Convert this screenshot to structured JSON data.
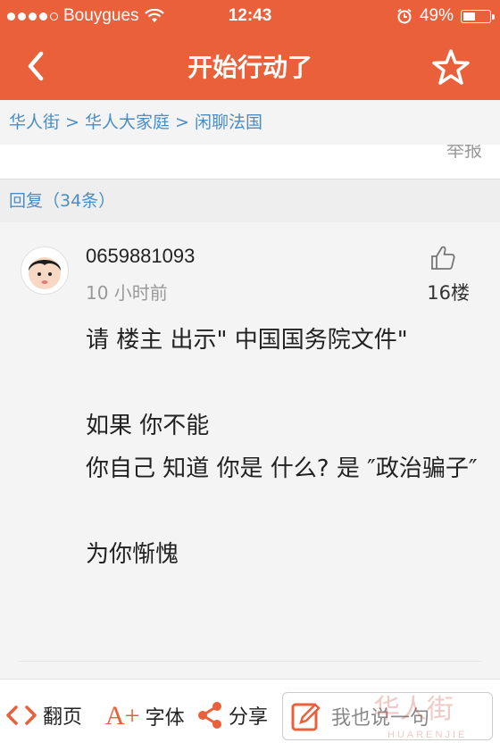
{
  "status": {
    "carrier": "Bouygues",
    "time": "12:43",
    "battery": "49%",
    "battery_level": 0.49
  },
  "nav": {
    "title": "开始行动了",
    "back_icon": "chevron-left-icon",
    "favorite_icon": "star-icon"
  },
  "breadcrumb": "华人街 > 华人大家庭 > 闲聊法国",
  "strip": {
    "report": "举报"
  },
  "replies_header": "回复（34条）",
  "post": {
    "username": "0659881093",
    "time": "10 小时前",
    "floor": "16楼",
    "lines": [
      "请 楼主 出示\" 中国国务院文件\"",
      "",
      "如果 你不能",
      "你自己 知道 你是 什么? 是 ″政治骗子″",
      "",
      "为你惭愧"
    ]
  },
  "toolbar": {
    "page_label": "翻页",
    "font_label": "字体",
    "font_icon_text": "A+",
    "share_label": "分享",
    "reply_placeholder": "我也说一句",
    "watermark": "华人街",
    "watermark_sub": "HUARENJIE"
  },
  "colors": {
    "header_bg": "#e9603a",
    "link": "#4a8dc6",
    "share_icon": "#e9603a"
  }
}
